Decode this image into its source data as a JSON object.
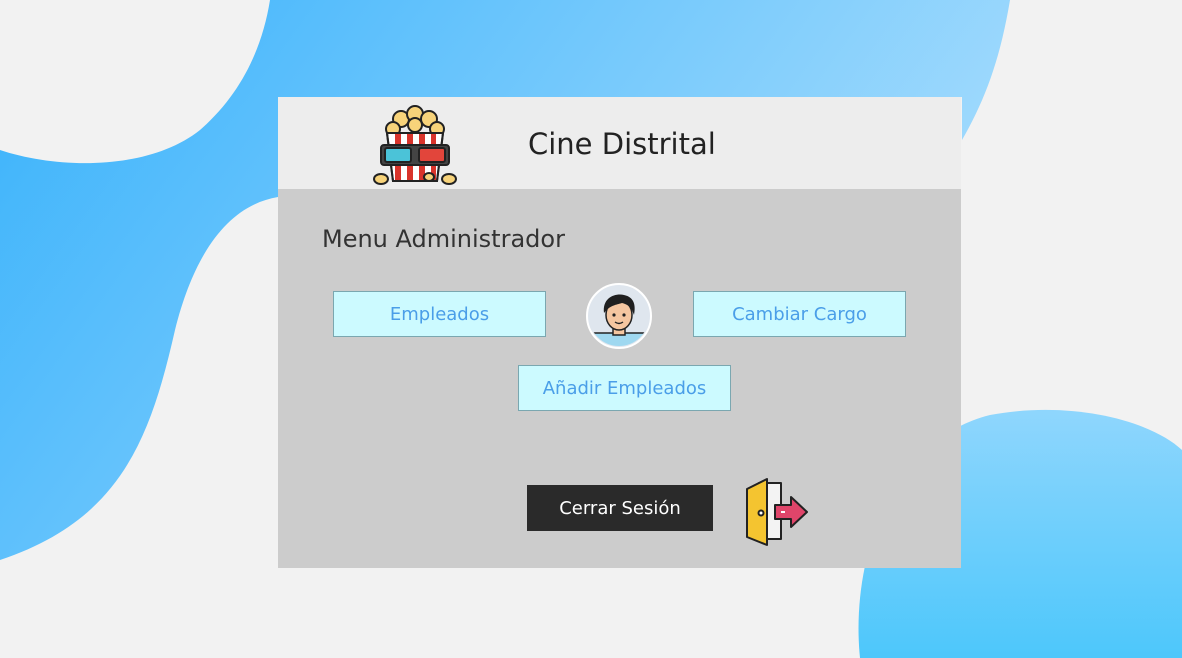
{
  "header": {
    "title": "Cine Distrital",
    "logo_icon": "popcorn-3d-glasses-icon"
  },
  "main": {
    "menu_title": "Menu Administrador",
    "buttons": {
      "empleados": "Empleados",
      "cambiar_cargo": "Cambiar Cargo",
      "anadir_empleados": "Añadir Empleados",
      "cerrar_sesion": "Cerrar Sesión"
    },
    "avatar_icon": "user-avatar-icon",
    "logout_icon": "exit-door-icon"
  },
  "colors": {
    "background": "#f2f2f2",
    "blob_blue": "#3ab4fb",
    "panel": "#cccccc",
    "header": "#ededed",
    "button_bg": "#ccfaff",
    "button_text": "#4a9ee8",
    "logout_bg": "#2a2a2a"
  }
}
